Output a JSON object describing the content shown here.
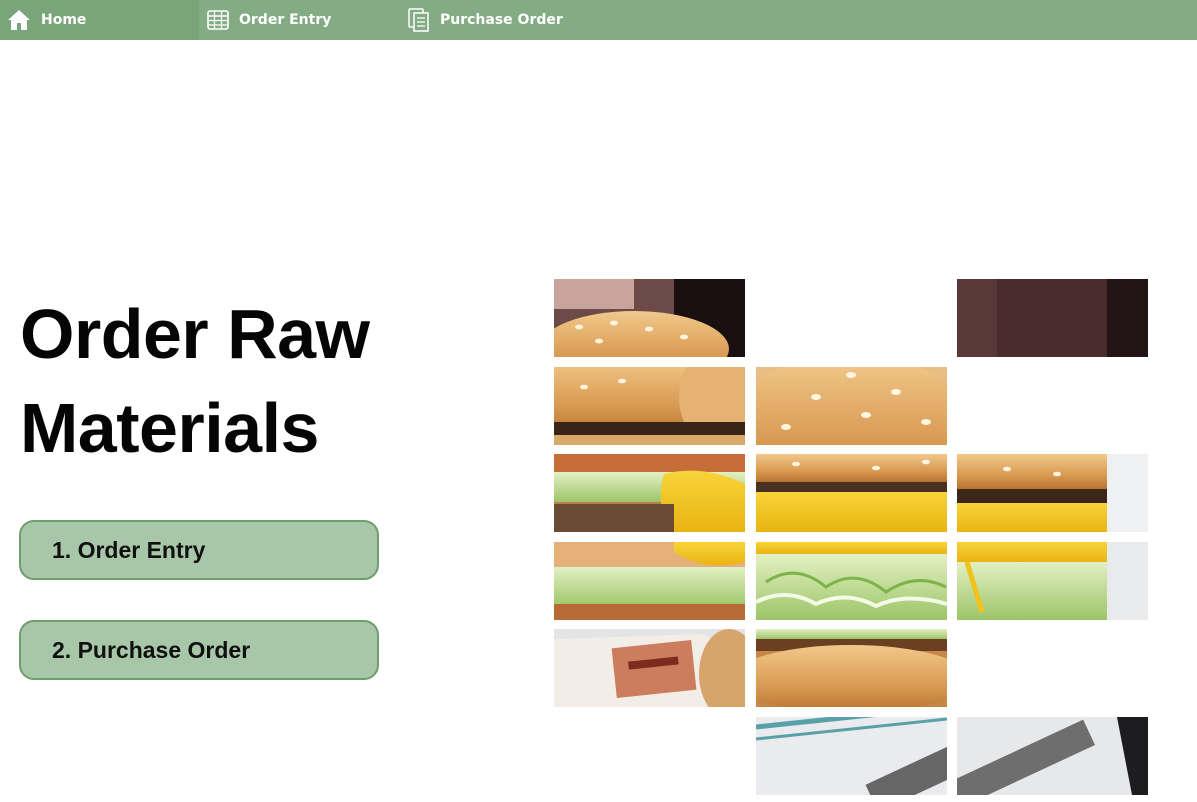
{
  "nav": {
    "items": [
      {
        "label": "Home",
        "icon": "home-icon"
      },
      {
        "label": "Order Entry",
        "icon": "table-icon"
      },
      {
        "label": "Purchase Order",
        "icon": "document-icon"
      }
    ]
  },
  "main": {
    "title": "Order Raw Materials",
    "buttons": [
      {
        "label": "1. Order Entry"
      },
      {
        "label": "2. Purchase Order"
      }
    ]
  },
  "colors": {
    "nav_bg": "#84ac84",
    "button_bg": "#a8c7a9",
    "button_border": "#6f9d70"
  },
  "image": {
    "subject": "burger photo mosaic"
  }
}
